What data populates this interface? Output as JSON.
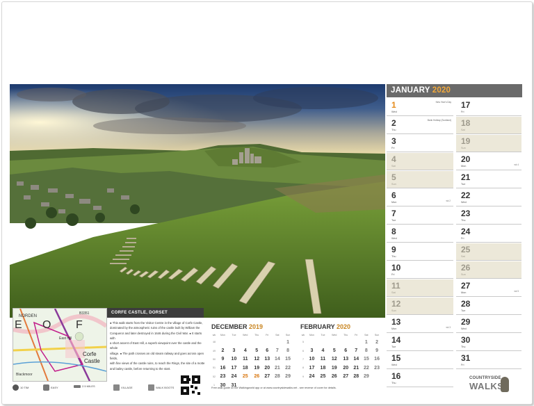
{
  "calendar": {
    "month": "JANUARY",
    "year": "2020",
    "days": [
      {
        "n": "1",
        "dow": "Wed",
        "note": "New Year's Day",
        "weekend": false,
        "holiday": true
      },
      {
        "n": "2",
        "dow": "Thu",
        "note": "Bank Holiday (Scotland)",
        "weekend": false,
        "holiday": false
      },
      {
        "n": "3",
        "dow": "Fri",
        "weekend": false,
        "holiday": false
      },
      {
        "n": "4",
        "dow": "Sat",
        "weekend": true,
        "holiday": false
      },
      {
        "n": "5",
        "dow": "Sun",
        "weekend": true,
        "holiday": false
      },
      {
        "n": "6",
        "dow": "Mon",
        "wk": "wk 2",
        "weekend": false,
        "holiday": false
      },
      {
        "n": "7",
        "dow": "Tue",
        "weekend": false,
        "holiday": false
      },
      {
        "n": "8",
        "dow": "Wed",
        "weekend": false,
        "holiday": false
      },
      {
        "n": "9",
        "dow": "Thu",
        "weekend": false,
        "holiday": false
      },
      {
        "n": "10",
        "dow": "Fri",
        "weekend": false,
        "holiday": false
      },
      {
        "n": "11",
        "dow": "Sat",
        "weekend": true,
        "holiday": false
      },
      {
        "n": "12",
        "dow": "Sun",
        "weekend": true,
        "holiday": false
      },
      {
        "n": "13",
        "dow": "Mon",
        "wk": "wk 3",
        "weekend": false,
        "holiday": false
      },
      {
        "n": "14",
        "dow": "Tue",
        "weekend": false,
        "holiday": false
      },
      {
        "n": "15",
        "dow": "Wed",
        "weekend": false,
        "holiday": false
      },
      {
        "n": "16",
        "dow": "Thu",
        "weekend": false,
        "holiday": false
      },
      {
        "n": "17",
        "dow": "Fri",
        "weekend": false,
        "holiday": false
      },
      {
        "n": "18",
        "dow": "Sat",
        "weekend": true,
        "holiday": false
      },
      {
        "n": "19",
        "dow": "Sun",
        "weekend": true,
        "holiday": false
      },
      {
        "n": "20",
        "dow": "Mon",
        "wk": "wk 4",
        "weekend": false,
        "holiday": false
      },
      {
        "n": "21",
        "dow": "Tue",
        "weekend": false,
        "holiday": false
      },
      {
        "n": "22",
        "dow": "Wed",
        "weekend": false,
        "holiday": false
      },
      {
        "n": "23",
        "dow": "Thu",
        "weekend": false,
        "holiday": false
      },
      {
        "n": "24",
        "dow": "Fri",
        "weekend": false,
        "holiday": false
      },
      {
        "n": "25",
        "dow": "Sat",
        "weekend": true,
        "holiday": false
      },
      {
        "n": "26",
        "dow": "Sun",
        "weekend": true,
        "holiday": false
      },
      {
        "n": "27",
        "dow": "Mon",
        "wk": "wk 5",
        "weekend": false,
        "holiday": false
      },
      {
        "n": "28",
        "dow": "Tue",
        "weekend": false,
        "holiday": false
      },
      {
        "n": "29",
        "dow": "Wed",
        "weekend": false,
        "holiday": false
      },
      {
        "n": "30",
        "dow": "Thu",
        "weekend": false,
        "holiday": false
      },
      {
        "n": "31",
        "dow": "Fri",
        "weekend": false,
        "holiday": false
      }
    ]
  },
  "mini_calendars": [
    {
      "month": "DECEMBER",
      "year": "2019",
      "headers": [
        "wk",
        "Mon",
        "Tue",
        "Wed",
        "Thu",
        "Fri",
        "Sat",
        "Sun"
      ],
      "rows": [
        {
          "wk": "48",
          "cells": [
            "",
            "",
            "",
            "",
            "",
            "",
            "1"
          ]
        },
        {
          "wk": "49",
          "cells": [
            "2",
            "3",
            "4",
            "5",
            "6",
            "7",
            "8"
          ]
        },
        {
          "wk": "50",
          "cells": [
            "9",
            "10",
            "11",
            "12",
            "13",
            "14",
            "15"
          ]
        },
        {
          "wk": "51",
          "cells": [
            "16",
            "17",
            "18",
            "19",
            "20",
            "21",
            "22"
          ]
        },
        {
          "wk": "52",
          "cells": [
            "23",
            "24",
            "25",
            "26",
            "27",
            "28",
            "29"
          ]
        },
        {
          "wk": "1",
          "cells": [
            "30",
            "31",
            "",
            "",
            "",
            "",
            ""
          ]
        }
      ],
      "holidays": [
        "25",
        "26"
      ]
    },
    {
      "month": "FEBRUARY",
      "year": "2020",
      "headers": [
        "wk",
        "Mon",
        "Tue",
        "Wed",
        "Thu",
        "Fri",
        "Sat",
        "Sun"
      ],
      "rows": [
        {
          "wk": "5",
          "cells": [
            "",
            "",
            "",
            "",
            "",
            "1",
            "2"
          ]
        },
        {
          "wk": "6",
          "cells": [
            "3",
            "4",
            "5",
            "6",
            "7",
            "8",
            "9"
          ]
        },
        {
          "wk": "7",
          "cells": [
            "10",
            "11",
            "12",
            "13",
            "14",
            "15",
            "16"
          ]
        },
        {
          "wk": "8",
          "cells": [
            "17",
            "18",
            "19",
            "20",
            "21",
            "22",
            "23"
          ]
        },
        {
          "wk": "9",
          "cells": [
            "24",
            "25",
            "26",
            "27",
            "28",
            "29",
            ""
          ]
        }
      ],
      "holidays": []
    }
  ],
  "walk": {
    "title": "CORFE CASTLE, DORSET",
    "paragraphs": [
      "● This walk starts from the Visitor Centre in the village of Corfe Castle,",
      "dominated by the atmospheric ruins of the castle built by William the",
      "Conqueror and later destroyed in 1646 during the Civil War. ● It starts with",
      "a short ascent of East Hill, a superb viewpoint over the castle and the whole",
      "village. ● The path crosses an old steam railway and goes across open fields,",
      "with fine views of the castle ruins, to reach the Rings, the site of a motte",
      "and bailey castle, before returning to the start."
    ],
    "stats": [
      {
        "icon": "distance-icon",
        "label": "10 TIM"
      },
      {
        "icon": "terrain-icon",
        "label": "EASY"
      },
      {
        "icon": "length-icon",
        "label": "2.5 MILES"
      },
      {
        "icon": "village-icon",
        "label": "VILLAGE"
      },
      {
        "icon": "boots-icon",
        "label": "WALK BOOTS"
      }
    ],
    "footnote": "Free walk guide on the Walkingworld app or at www.countrysidewalks.net - see reverse of cover for details."
  },
  "map": {
    "labels": [
      "NORDEN",
      "E",
      "O",
      "F",
      "Corfe",
      "Castle",
      "East Hill",
      "B3351",
      "Blackmoor"
    ]
  },
  "brand": {
    "line1": "COUNTRYSIDE",
    "line2": "WALKS"
  },
  "colors": {
    "accent": "#f2a93b",
    "holiday": "#e58b1a",
    "header": "#6a6a6a",
    "weekend": "#ece8d9"
  }
}
